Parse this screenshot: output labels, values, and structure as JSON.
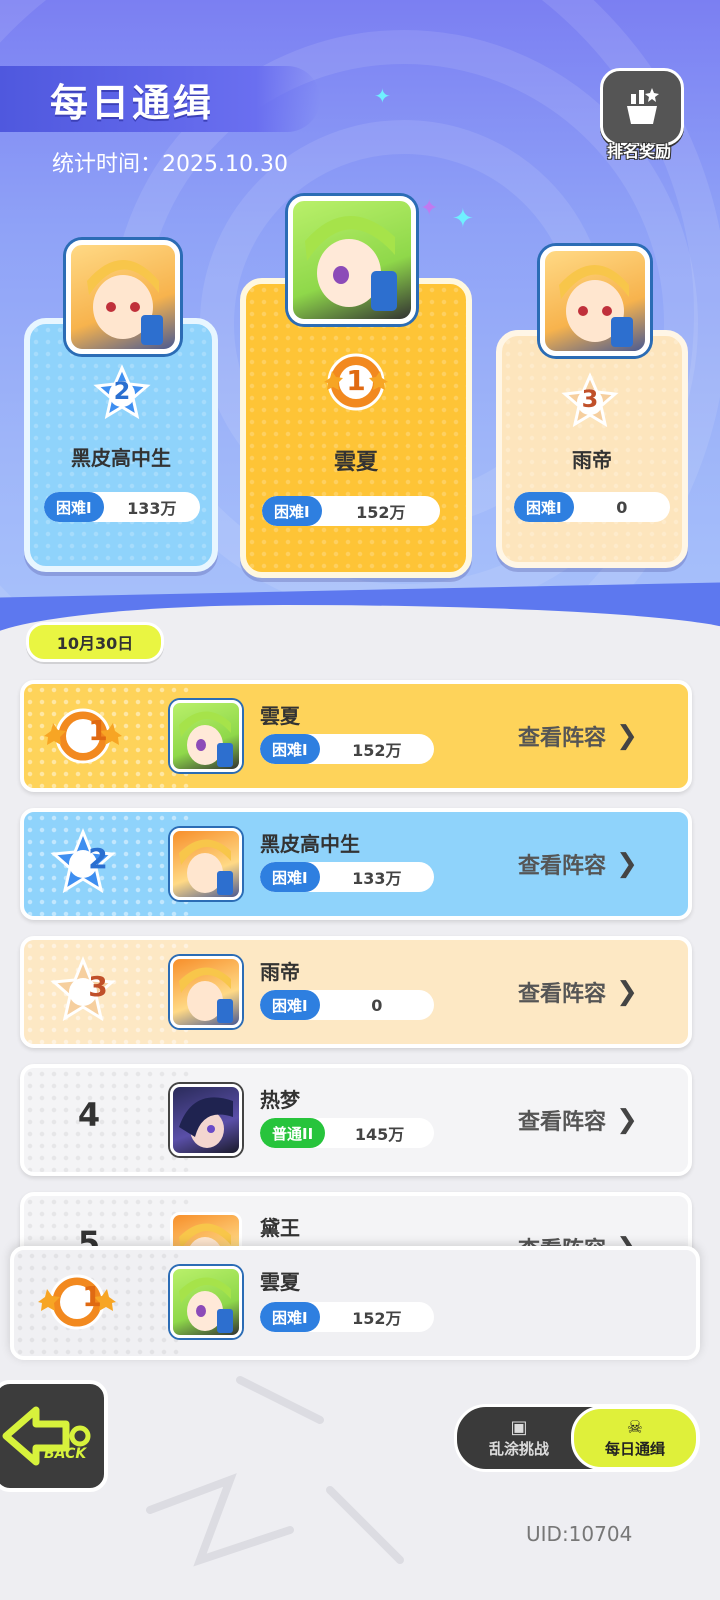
{
  "header": {
    "title": "每日通缉",
    "stat_time": "统计时间：2025.10.30",
    "reward_label": "排名奖励",
    "reward_icon": "podium-trophy-icon"
  },
  "podium": [
    {
      "rank": "2",
      "name": "黑皮高中生",
      "difficulty": "困难I",
      "score": "133万"
    },
    {
      "rank": "1",
      "name": "雲夏",
      "difficulty": "困难I",
      "score": "152万"
    },
    {
      "rank": "3",
      "name": "雨帝",
      "difficulty": "困难I",
      "score": "0"
    }
  ],
  "list": {
    "date": "10月30日",
    "view_label": "查看阵容",
    "rows": [
      {
        "rank": "1",
        "name": "雲夏",
        "difficulty": "困难I",
        "score": "152万"
      },
      {
        "rank": "2",
        "name": "黑皮高中生",
        "difficulty": "困难I",
        "score": "133万"
      },
      {
        "rank": "3",
        "name": "雨帝",
        "difficulty": "困难I",
        "score": "0"
      },
      {
        "rank": "4",
        "name": "热梦",
        "difficulty": "普通II",
        "score": "145万"
      },
      {
        "rank": "5",
        "name": "黛王",
        "difficulty": "",
        "score": ""
      }
    ]
  },
  "my_rank": {
    "rank": "1",
    "name": "雲夏",
    "difficulty": "困难I",
    "score": "152万"
  },
  "footer": {
    "back_label": "BACK",
    "tabs": [
      {
        "label": "乱涂挑战",
        "icon": "gameboy-icon",
        "active": false
      },
      {
        "label": "每日通缉",
        "icon": "cat-skull-icon",
        "active": true
      }
    ],
    "uid": "UID:10704"
  },
  "colors": {
    "gold": "#fec436",
    "blue": "#8fd3fb",
    "bronze": "#fde5bd",
    "hard_tag": "#2e7fe0",
    "normal_tag": "#27c43c",
    "active_tab": "#dff03a"
  }
}
